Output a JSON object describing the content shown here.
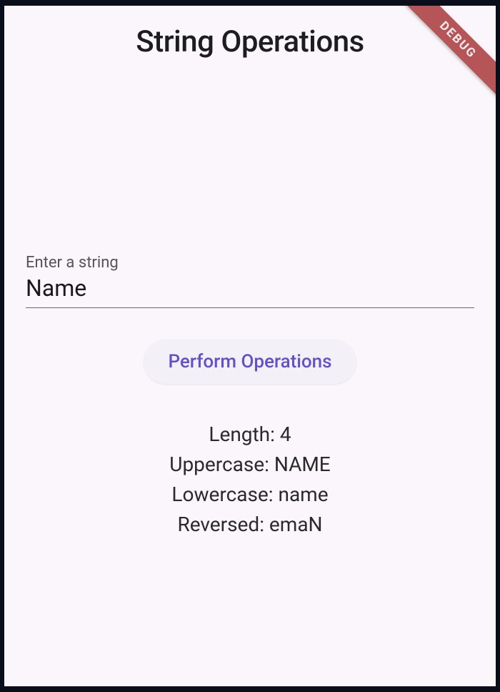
{
  "header": {
    "title": "String Operations"
  },
  "input": {
    "label": "Enter a string",
    "value": "Name"
  },
  "button": {
    "label": "Perform Operations"
  },
  "results": {
    "length": "Length: 4",
    "uppercase": "Uppercase: NAME",
    "lowercase": "Lowercase: name",
    "reversed": "Reversed: emaN"
  },
  "debug": {
    "label": "DEBUG"
  }
}
